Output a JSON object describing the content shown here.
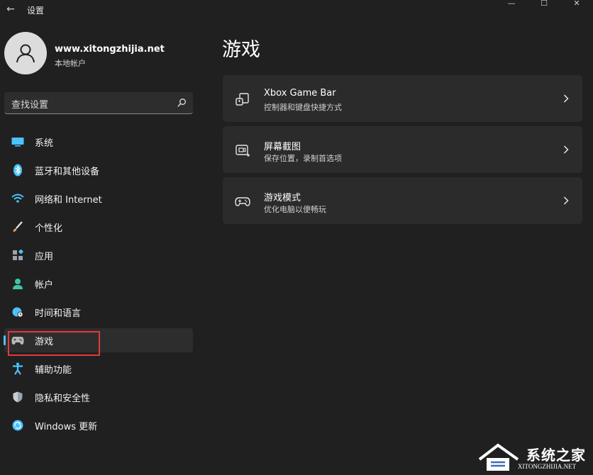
{
  "window": {
    "title": "设置",
    "back_glyph": "←",
    "minimize_glyph": "—",
    "maximize_glyph": "☐",
    "close_glyph": "✕"
  },
  "profile": {
    "name": "www.xitongzhijia.net",
    "account_type": "本地帐户"
  },
  "search": {
    "placeholder": "查找设置"
  },
  "sidebar": {
    "items": [
      {
        "label": "系统",
        "icon": "monitor-icon",
        "color": "#4cc2ff"
      },
      {
        "label": "蓝牙和其他设备",
        "icon": "bluetooth-icon",
        "color": "#4cc2ff"
      },
      {
        "label": "网络和 Internet",
        "icon": "wifi-icon",
        "color": "#4cc2ff"
      },
      {
        "label": "个性化",
        "icon": "brush-icon",
        "color": "#e8a060"
      },
      {
        "label": "应用",
        "icon": "apps-icon",
        "color": "#9aa4ae"
      },
      {
        "label": "帐户",
        "icon": "person-icon",
        "color": "#3fc5a5"
      },
      {
        "label": "时间和语言",
        "icon": "globe-clock-icon",
        "color": "#4cc2ff"
      },
      {
        "label": "游戏",
        "icon": "gamepad-icon",
        "color": "#b8b8b8",
        "active": true
      },
      {
        "label": "辅助功能",
        "icon": "accessibility-icon",
        "color": "#4cc2ff"
      },
      {
        "label": "隐私和安全性",
        "icon": "shield-icon",
        "color": "#9aa4ae"
      },
      {
        "label": "Windows 更新",
        "icon": "update-icon",
        "color": "#4cc2ff"
      }
    ]
  },
  "main": {
    "title": "游戏",
    "cards": [
      {
        "title": "Xbox Game Bar",
        "subtitle": "控制器和键盘快捷方式",
        "icon": "game-bar-icon"
      },
      {
        "title": "屏幕截图",
        "subtitle": "保存位置，录制首选项",
        "icon": "capture-icon"
      },
      {
        "title": "游戏模式",
        "subtitle": "优化电脑以便畅玩",
        "icon": "game-mode-icon"
      }
    ]
  },
  "watermark": {
    "text": "系统之家",
    "url": "XITONGZHIJIA.NET"
  },
  "colors": {
    "background": "#202020",
    "card": "#2b2b2b",
    "accent": "#4cc2ff",
    "highlight": "#e03a3a"
  }
}
